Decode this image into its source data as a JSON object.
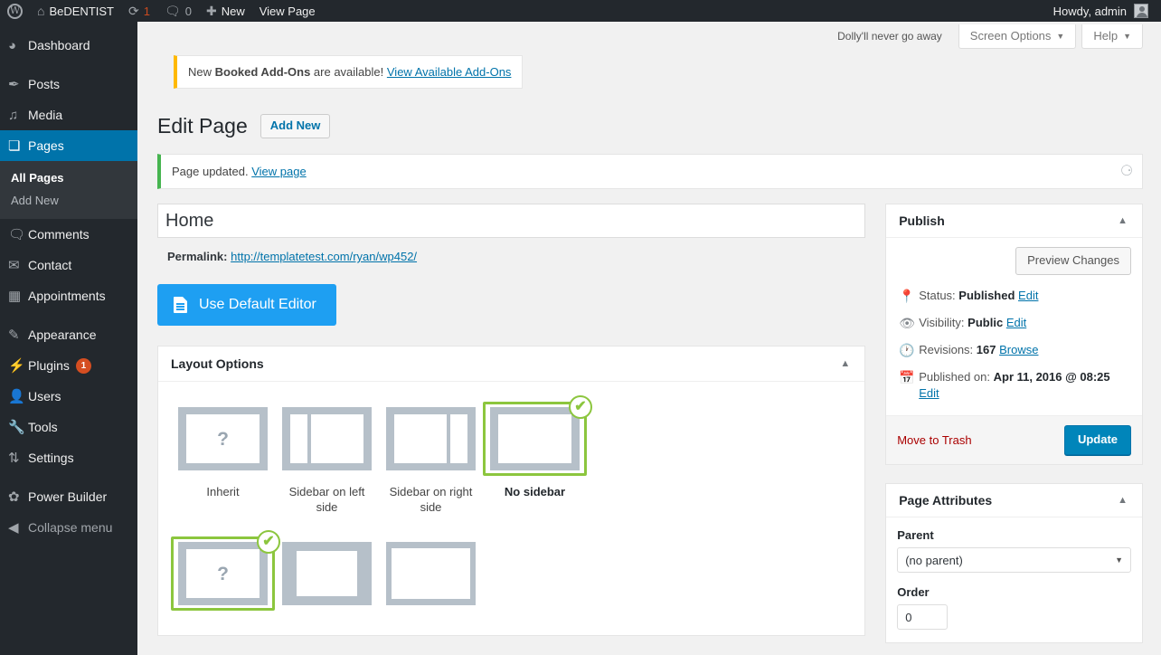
{
  "adminbar": {
    "wp_logo": "wordpress-logo",
    "site_name": "BeDENTIST",
    "updates_count": "1",
    "comments_count": "0",
    "new_label": "New",
    "view_page_label": "View Page",
    "howdy": "Howdy, admin"
  },
  "sidebar": {
    "items": [
      {
        "label": "Dashboard",
        "icon": "dashboard-icon",
        "glyph": "◕"
      },
      {
        "label": "Posts",
        "icon": "pin-icon",
        "glyph": "✒"
      },
      {
        "label": "Media",
        "icon": "media-icon",
        "glyph": "♫"
      },
      {
        "label": "Pages",
        "icon": "pages-icon",
        "glyph": "❏",
        "current": true
      },
      {
        "label": "Comments",
        "icon": "comments-icon",
        "glyph": "🗩"
      },
      {
        "label": "Contact",
        "icon": "mail-icon",
        "glyph": "✉"
      },
      {
        "label": "Appointments",
        "icon": "calendar-icon",
        "glyph": "▦"
      },
      {
        "label": "Appearance",
        "icon": "brush-icon",
        "glyph": "✎"
      },
      {
        "label": "Plugins",
        "icon": "plug-icon",
        "glyph": "⚡",
        "badge": "1"
      },
      {
        "label": "Users",
        "icon": "user-icon",
        "glyph": "👤"
      },
      {
        "label": "Tools",
        "icon": "wrench-icon",
        "glyph": "🔧"
      },
      {
        "label": "Settings",
        "icon": "settings-icon",
        "glyph": "⚙"
      },
      {
        "label": "Power Builder",
        "icon": "gear-icon",
        "glyph": "✿"
      },
      {
        "label": "Collapse menu",
        "icon": "collapse-icon",
        "glyph": "◀"
      }
    ],
    "submenu": {
      "parent": "Pages",
      "items": [
        {
          "label": "All Pages",
          "current": true
        },
        {
          "label": "Add New",
          "current": false
        }
      ]
    }
  },
  "screen_meta": {
    "dolly_text": "Dolly'll never go away",
    "screen_options": "Screen Options",
    "help": "Help",
    "caret": "▼"
  },
  "notices": {
    "addons": {
      "prefix": "New ",
      "strong": "Booked Add-Ons",
      "suffix": " are available! ",
      "link": "View Available Add-Ons"
    },
    "updated": {
      "text": "Page updated. ",
      "link": "View page",
      "dismiss_icon": "close-icon"
    }
  },
  "header": {
    "title": "Edit Page",
    "add_new": "Add New"
  },
  "editor": {
    "title_value": "Home",
    "title_placeholder": "Enter title here",
    "permalink_label": "Permalink:",
    "permalink_url": "http://templatetest.com/ryan/wp452/",
    "default_editor_button": "Use Default Editor"
  },
  "layout_options": {
    "panel_title": "Layout Options",
    "toggle_icon": "chevron-up-icon",
    "row1": [
      {
        "label": "Inherit",
        "type": "inherit",
        "selected": false
      },
      {
        "label": "Sidebar on left side",
        "type": "sidebar-left",
        "selected": false
      },
      {
        "label": "Sidebar on right side",
        "type": "sidebar-right",
        "selected": false
      },
      {
        "label": "No sidebar",
        "type": "no-sidebar",
        "selected": true
      }
    ],
    "row2": [
      {
        "label": "",
        "type": "inherit",
        "selected": true
      },
      {
        "label": "",
        "type": "boxed",
        "selected": false
      },
      {
        "label": "",
        "type": "wide",
        "selected": false
      }
    ],
    "question_mark": "?",
    "check_icon": "✔"
  },
  "publish": {
    "panel_title": "Publish",
    "toggle_icon": "chevron-up-icon",
    "preview_button": "Preview Changes",
    "status_label": "Status:",
    "status_value": "Published",
    "status_edit": "Edit",
    "visibility_label": "Visibility:",
    "visibility_value": "Public",
    "visibility_edit": "Edit",
    "revisions_label": "Revisions:",
    "revisions_value": "167",
    "revisions_browse": "Browse",
    "published_label": "Published on:",
    "published_value": "Apr 11, 2016 @ 08:25",
    "published_edit": "Edit",
    "trash_link": "Move to Trash",
    "update_button": "Update"
  },
  "page_attributes": {
    "panel_title": "Page Attributes",
    "toggle_icon": "chevron-up-icon",
    "parent_label": "Parent",
    "parent_value": "(no parent)",
    "parent_arrow": "▼",
    "order_label": "Order",
    "order_value": "0"
  },
  "colors": {
    "admin_blue": "#0073aa",
    "admin_dark": "#23282d",
    "accent_green": "#8cc63e",
    "notice_green": "#46b450",
    "notice_yellow": "#ffb900",
    "button_blue": "#1e9ff2",
    "badge_orange": "#d54e21"
  }
}
